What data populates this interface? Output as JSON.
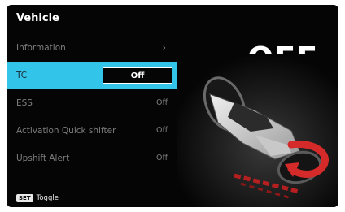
{
  "screen": {
    "title": "Vehicle",
    "status_text": "OFF"
  },
  "menu": {
    "items": [
      {
        "label": "Information",
        "value": "",
        "has_submenu": true
      },
      {
        "label": "TC",
        "value": "Off",
        "selected": true
      },
      {
        "label": "ESS",
        "value": "Off"
      },
      {
        "label": "Activation Quick shifter",
        "value": "Off"
      },
      {
        "label": "Upshift Alert",
        "value": "Off"
      }
    ]
  },
  "footer": {
    "key_label": "SET",
    "action_label": "Toggle"
  },
  "icons": {
    "submenu": "chevron-right-icon",
    "illustration": "motorcycle-traction-icon"
  },
  "colors": {
    "selection": "#33c4ea",
    "background": "#050505",
    "accent_red": "#d42a2a"
  }
}
